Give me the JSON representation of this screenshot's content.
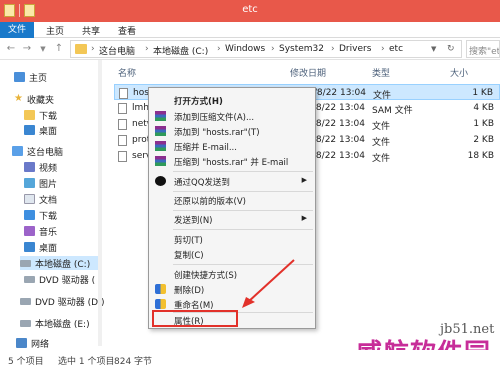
{
  "window": {
    "title": "etc"
  },
  "ribbon": {
    "tabs": [
      "文件",
      "主页",
      "共享",
      "查看"
    ]
  },
  "address": {
    "crumbs": [
      "这台电脑",
      "本地磁盘 (C:)",
      "Windows",
      "System32",
      "Drivers",
      "etc"
    ],
    "search_placeholder": "搜索\"etc\""
  },
  "nav": {
    "items": [
      {
        "label": "主页",
        "icon": "home-icon"
      },
      {
        "label": "收藏夹",
        "icon": "star-icon"
      },
      {
        "label": "下载",
        "icon": "folder-icon"
      },
      {
        "label": "桌面",
        "icon": "desktop-icon"
      },
      {
        "label": "这台电脑",
        "icon": "computer-icon"
      },
      {
        "label": "视频",
        "icon": "video-folder-icon"
      },
      {
        "label": "图片",
        "icon": "picture-folder-icon"
      },
      {
        "label": "文档",
        "icon": "document-folder-icon"
      },
      {
        "label": "下载",
        "icon": "download-folder-icon"
      },
      {
        "label": "音乐",
        "icon": "music-folder-icon"
      },
      {
        "label": "桌面",
        "icon": "desktop-icon"
      },
      {
        "label": "本地磁盘 (C:)",
        "icon": "drive-icon"
      },
      {
        "label": "DVD 驱动器 (",
        "icon": "dvd-drive-icon"
      },
      {
        "label": "DVD 驱动器 (D:)",
        "icon": "dvd-drive-icon"
      },
      {
        "label": "本地磁盘 (E:)",
        "icon": "drive-icon"
      },
      {
        "label": "网络",
        "icon": "network-icon"
      }
    ]
  },
  "columns": {
    "name": "名称",
    "date": "修改日期",
    "type": "类型",
    "size": "大小"
  },
  "files": [
    {
      "name": "hosts",
      "date": "2013/8/22 13:04",
      "type": "文件",
      "size": "1 KB"
    },
    {
      "name": "lmhosts.sam",
      "date": "2013/8/22 13:04",
      "type": "SAM 文件",
      "size": "4 KB"
    },
    {
      "name": "networks",
      "date": "2013/8/22 13:04",
      "type": "文件",
      "size": "1 KB"
    },
    {
      "name": "protocol",
      "date": "2013/8/22 13:04",
      "type": "文件",
      "size": "2 KB"
    },
    {
      "name": "services",
      "date": "2013/8/22 13:04",
      "type": "文件",
      "size": "18 KB"
    }
  ],
  "context_menu": {
    "open_with": "打开方式(H)",
    "add_archive": "添加到压缩文件(A)...",
    "add_rar": "添加到 \"hosts.rar\"(T)",
    "compress_email": "压缩并 E-mail...",
    "compress_rar_email": "压缩到 \"hosts.rar\" 并 E-mail",
    "qq_send": "通过QQ发送到",
    "restore": "还原以前的版本(V)",
    "send_to": "发送到(N)",
    "cut": "剪切(T)",
    "copy": "复制(C)",
    "create_shortcut": "创建快捷方式(S)",
    "delete": "删除(D)",
    "rename": "重命名(M)",
    "properties": "属性(R)"
  },
  "status": {
    "count": "5 个项目",
    "selected": "选中 1 个项目",
    "size": "824 字节"
  },
  "watermark": {
    "site": "jb51.net",
    "brand": "威航软件园"
  },
  "colors": {
    "titlebar": "#e8584a",
    "file_tab": "#1979ca",
    "selection": "#cde8ff",
    "annotation": "#e2312a",
    "watermark": "#c2178f"
  }
}
